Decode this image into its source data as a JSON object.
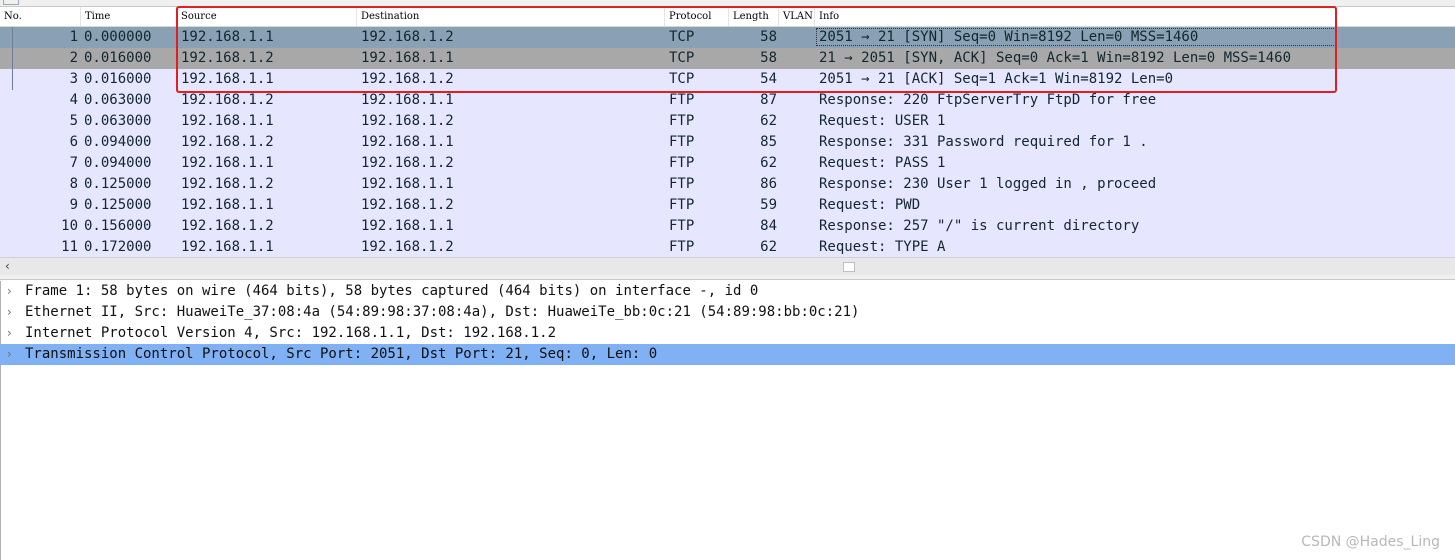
{
  "columns": {
    "no": "No.",
    "time": "Time",
    "source": "Source",
    "destination": "Destination",
    "protocol": "Protocol",
    "length": "Length",
    "vlan": "VLAN",
    "info": "Info"
  },
  "packets": [
    {
      "no": "1",
      "time": "0.000000",
      "source": "192.168.1.1",
      "destination": "192.168.1.2",
      "protocol": "TCP",
      "length": "58",
      "info": "2051 → 21 [SYN] Seq=0 Win=8192 Len=0 MSS=1460"
    },
    {
      "no": "2",
      "time": "0.016000",
      "source": "192.168.1.2",
      "destination": "192.168.1.1",
      "protocol": "TCP",
      "length": "58",
      "info": "21 → 2051 [SYN, ACK] Seq=0 Ack=1 Win=8192 Len=0 MSS=1460"
    },
    {
      "no": "3",
      "time": "0.016000",
      "source": "192.168.1.1",
      "destination": "192.168.1.2",
      "protocol": "TCP",
      "length": "54",
      "info": "2051 → 21 [ACK] Seq=1 Ack=1 Win=8192 Len=0"
    },
    {
      "no": "4",
      "time": "0.063000",
      "source": "192.168.1.2",
      "destination": "192.168.1.1",
      "protocol": "FTP",
      "length": "87",
      "info": "Response: 220 FtpServerTry FtpD for free"
    },
    {
      "no": "5",
      "time": "0.063000",
      "source": "192.168.1.1",
      "destination": "192.168.1.2",
      "protocol": "FTP",
      "length": "62",
      "info": "Request: USER 1"
    },
    {
      "no": "6",
      "time": "0.094000",
      "source": "192.168.1.2",
      "destination": "192.168.1.1",
      "protocol": "FTP",
      "length": "85",
      "info": "Response: 331 Password required for 1 ."
    },
    {
      "no": "7",
      "time": "0.094000",
      "source": "192.168.1.1",
      "destination": "192.168.1.2",
      "protocol": "FTP",
      "length": "62",
      "info": "Request: PASS 1"
    },
    {
      "no": "8",
      "time": "0.125000",
      "source": "192.168.1.2",
      "destination": "192.168.1.1",
      "protocol": "FTP",
      "length": "86",
      "info": "Response: 230 User 1 logged in , proceed"
    },
    {
      "no": "9",
      "time": "0.125000",
      "source": "192.168.1.1",
      "destination": "192.168.1.2",
      "protocol": "FTP",
      "length": "59",
      "info": "Request: PWD"
    },
    {
      "no": "10",
      "time": "0.156000",
      "source": "192.168.1.2",
      "destination": "192.168.1.1",
      "protocol": "FTP",
      "length": "84",
      "info": "Response: 257 \"/\" is current directory"
    },
    {
      "no": "11",
      "time": "0.172000",
      "source": "192.168.1.1",
      "destination": "192.168.1.2",
      "protocol": "FTP",
      "length": "62",
      "info": "Request: TYPE A"
    }
  ],
  "details": [
    "Frame 1: 58 bytes on wire (464 bits), 58 bytes captured (464 bits) on interface -, id 0",
    "Ethernet II, Src: HuaweiTe_37:08:4a (54:89:98:37:08:4a), Dst: HuaweiTe_bb:0c:21 (54:89:98:bb:0c:21)",
    "Internet Protocol Version 4, Src: 192.168.1.1, Dst: 192.168.1.2",
    "Transmission Control Protocol, Src Port: 2051, Dst Port: 21, Seq: 0, Len: 0"
  ],
  "icons": {
    "expand": "chevron-right-icon",
    "scroll_left": "arrow-left-icon"
  },
  "glyphs": {
    "chevron": "›",
    "left_arrow": "‹"
  },
  "colors": {
    "row_background": "#e7e6ff",
    "selected_row_1": "#8aa0b4",
    "selected_row_2": "#a8a8a8",
    "details_selected": "#7fb1f4",
    "annotation_box": "#e02020"
  },
  "watermark": "CSDN @Hades_Ling"
}
